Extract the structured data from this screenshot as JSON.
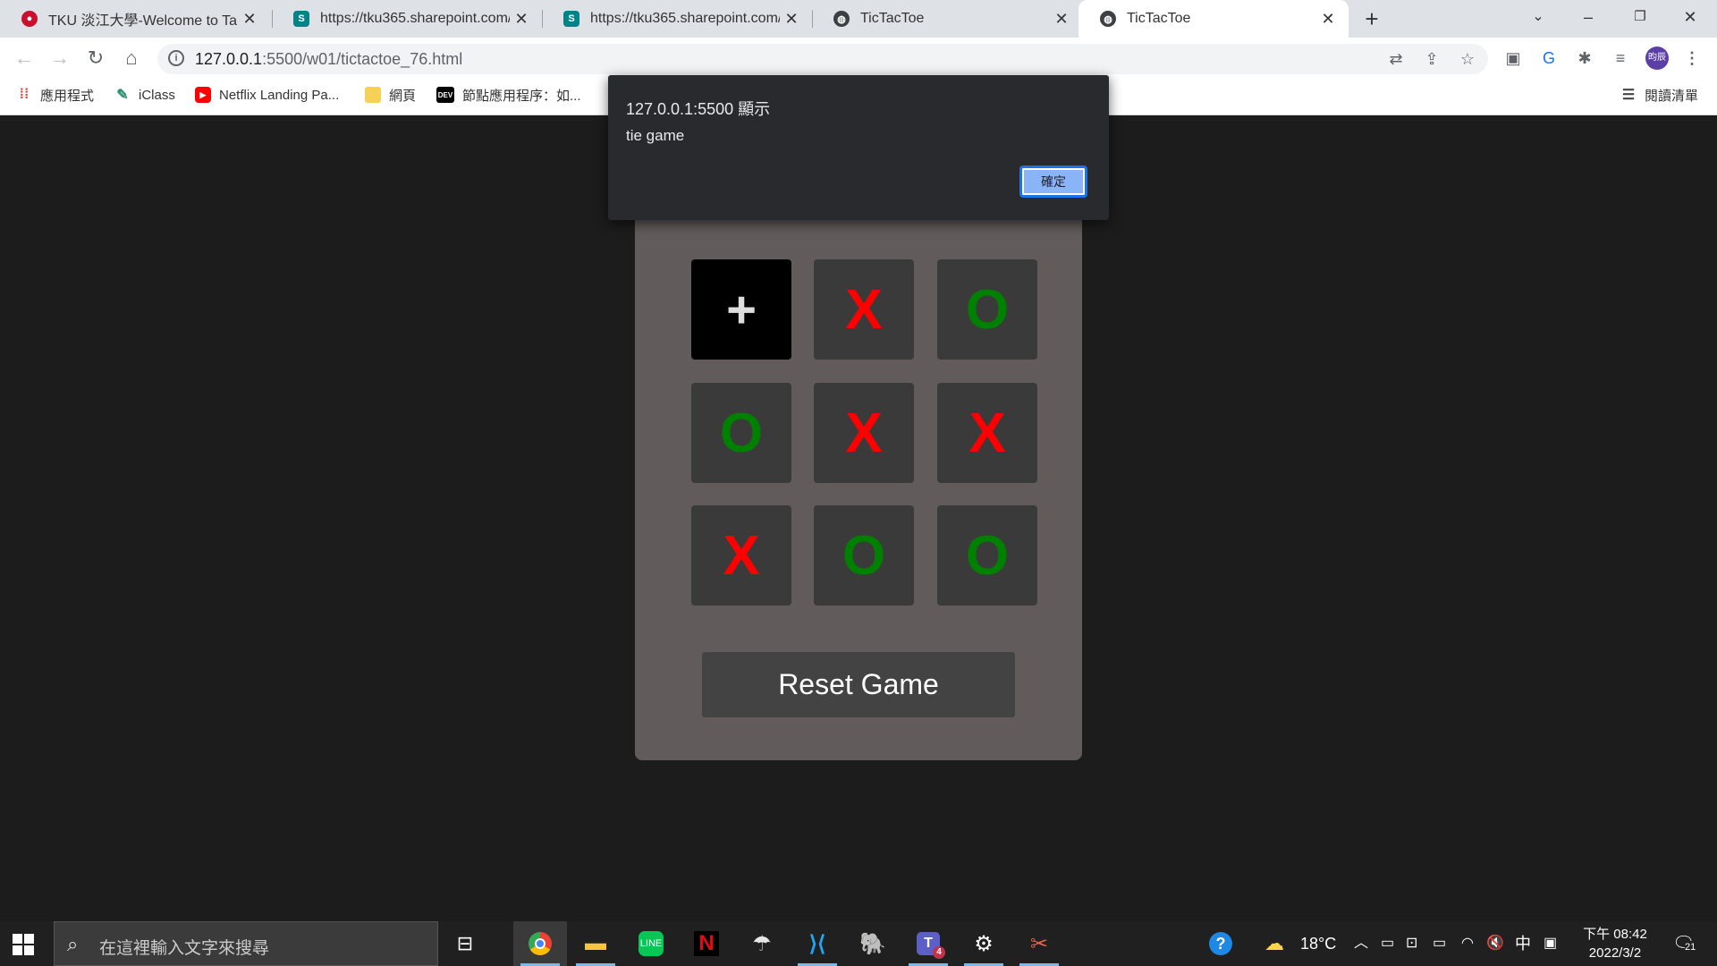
{
  "browser": {
    "tabs": [
      {
        "title": "TKU 淡江大學-Welcome to Tam",
        "favicon": "tku-logo-icon"
      },
      {
        "title": "https://tku365.sharepoint.com/",
        "favicon": "sharepoint-icon"
      },
      {
        "title": "https://tku365.sharepoint.com/",
        "favicon": "sharepoint-icon"
      },
      {
        "title": "TicTacToe",
        "favicon": "globe-icon"
      },
      {
        "title": "TicTacToe",
        "favicon": "globe-icon",
        "active": true
      }
    ],
    "url": "127.0.0.1:5500/w01/tictactoe_76.html",
    "url_host": "127.0.0.1",
    "url_rest": ":5500/w01/tictactoe_76.html",
    "profile_initials": "昀辰",
    "bookmarks": [
      {
        "label": "應用程式",
        "icon": "apps-grid-icon"
      },
      {
        "label": "iClass",
        "icon": "iclass-icon"
      },
      {
        "label": "Netflix Landing Pa...",
        "icon": "youtube-icon"
      },
      {
        "label": "網頁",
        "icon": "folder-icon"
      },
      {
        "label": "節點應用程序：如...",
        "icon": "dev-icon"
      }
    ],
    "reading_list": "閱讀清單",
    "dev_badge": "DEV"
  },
  "dialog": {
    "origin": "127.0.0.1:5500 顯示",
    "message": "tie game",
    "ok_label": "確定"
  },
  "game": {
    "board": [
      "+",
      "X",
      "O",
      "O",
      "X",
      "X",
      "X",
      "O",
      "O"
    ],
    "reset_label": "Reset Game",
    "colors": {
      "x": "#ff0000",
      "o": "#008000",
      "card": "#615b5b",
      "cell": "#3a3a3a"
    }
  },
  "taskbar": {
    "search_placeholder": "在這裡輸入文字來搜尋",
    "temperature": "18°C",
    "ime": "中",
    "time": "下午 08:42",
    "date": "2022/3/2",
    "notification_count": "21",
    "teams_badge": "4"
  }
}
